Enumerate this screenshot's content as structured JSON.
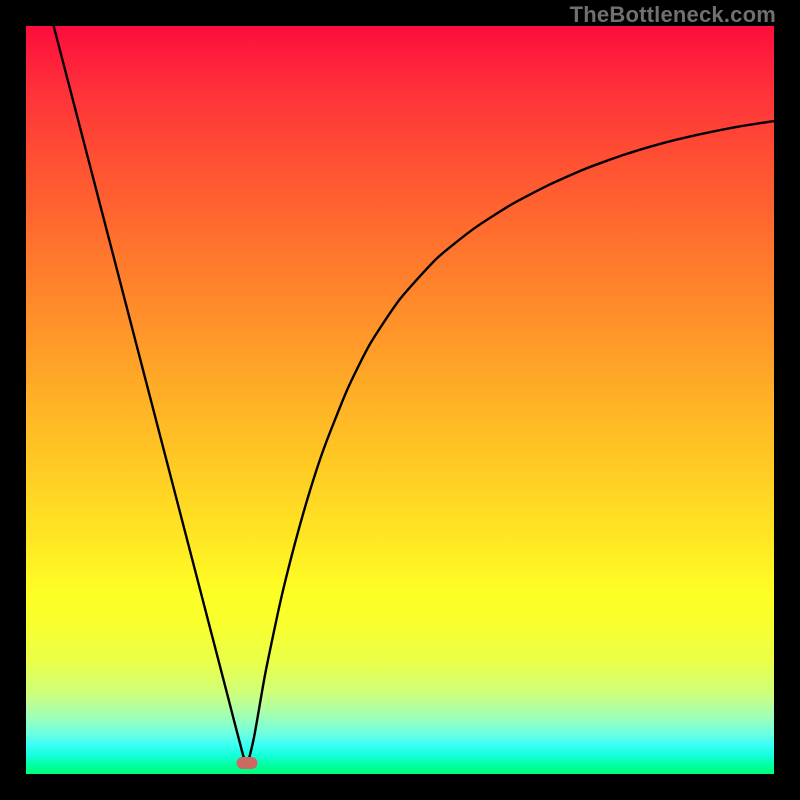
{
  "watermark": "TheBottleneck.com",
  "chart_data": {
    "type": "line",
    "title": "",
    "xlabel": "",
    "ylabel": "",
    "xlim": [
      0,
      100
    ],
    "ylim": [
      0,
      100
    ],
    "grid": false,
    "legend": false,
    "background_gradient_stops": [
      {
        "pct": 0,
        "color": "#fd0d3d"
      },
      {
        "pct": 18,
        "color": "#ff5033"
      },
      {
        "pct": 38,
        "color": "#ff8d2a"
      },
      {
        "pct": 58,
        "color": "#ffc824"
      },
      {
        "pct": 76,
        "color": "#fdff26"
      },
      {
        "pct": 89,
        "color": "#d0ff78"
      },
      {
        "pct": 96,
        "color": "#3efff6"
      },
      {
        "pct": 100,
        "color": "#00ff77"
      }
    ],
    "minimum_point": {
      "x": 29.5,
      "y": 1.5
    },
    "series": [
      {
        "name": "bottleneck-curve",
        "x": [
          3.7,
          5,
          7,
          9,
          11,
          13,
          15,
          17,
          19,
          21,
          23,
          25,
          27,
          28.5,
          29.5,
          30.5,
          32,
          34,
          36,
          38,
          40,
          43,
          46,
          50,
          55,
          60,
          65,
          70,
          75,
          80,
          85,
          90,
          95,
          100
        ],
        "y": [
          100,
          95.0,
          87.3,
          79.6,
          71.9,
          64.2,
          56.5,
          48.8,
          41.1,
          33.4,
          25.7,
          18.0,
          10.3,
          4.5,
          1.3,
          5.0,
          13.5,
          23.0,
          31.0,
          38.0,
          44.0,
          51.5,
          57.5,
          63.5,
          69.0,
          73.0,
          76.2,
          78.8,
          81.0,
          82.8,
          84.3,
          85.5,
          86.5,
          87.3
        ]
      }
    ],
    "curve_color": "#000000"
  }
}
